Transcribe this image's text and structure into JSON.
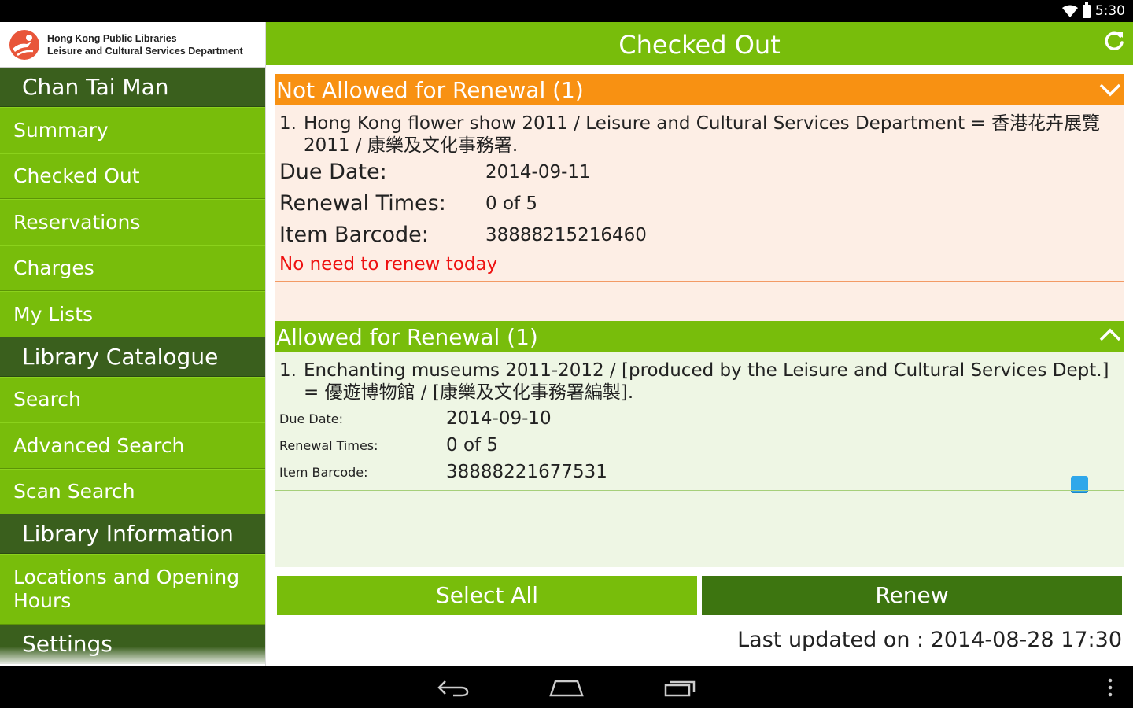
{
  "status_bar": {
    "time": "5:30"
  },
  "sidebar": {
    "logo_line1": "Hong Kong Public Libraries",
    "logo_line2": "Leisure and Cultural Services Department",
    "user_name": "Chan Tai Man",
    "account_items": [
      "Summary",
      "Checked Out",
      "Reservations",
      "Charges",
      "My Lists"
    ],
    "catalogue_header": "Library Catalogue",
    "catalogue_items": [
      "Search",
      "Advanced Search",
      "Scan Search"
    ],
    "info_header": "Library Information",
    "info_items": [
      "Locations and Opening Hours"
    ],
    "settings_header": "Settings"
  },
  "header": {
    "title": "Checked Out"
  },
  "not_allowed": {
    "header": "Not Allowed for Renewal (1)",
    "item_number": "1.",
    "item_title": "Hong Kong flower show 2011 / Leisure and Cultural Services Department = 香港花卉展覽 2011 / 康樂及文化事務署.",
    "due_date_label": "Due Date:",
    "due_date": "2014-09-11",
    "renewal_label": "Renewal Times:",
    "renewal_times": "0 of 5",
    "barcode_label": "Item Barcode:",
    "barcode": "38888215216460",
    "note": "No need to renew today"
  },
  "allowed": {
    "header": "Allowed for Renewal (1)",
    "item_number": "1.",
    "item_title": "Enchanting museums 2011-2012 / [produced by the Leisure and Cultural Services Dept.] = 優遊博物館 / [康樂及文化事務署編製].",
    "due_date_label": "Due Date:",
    "due_date": "2014-09-10",
    "renewal_label": "Renewal Times:",
    "renewal_times": "0 of 5",
    "barcode_label": "Item Barcode:",
    "barcode": "38888221677531"
  },
  "buttons": {
    "select_all": "Select All",
    "renew": "Renew"
  },
  "footer": {
    "last_updated": "Last updated on : 2014-08-28 17:30"
  },
  "colors": {
    "green": "#78bd0b",
    "dark_green": "#3a5f1d",
    "orange": "#f89112",
    "alert_red": "#ee1010",
    "checkbox_blue": "#2fa7ea"
  }
}
